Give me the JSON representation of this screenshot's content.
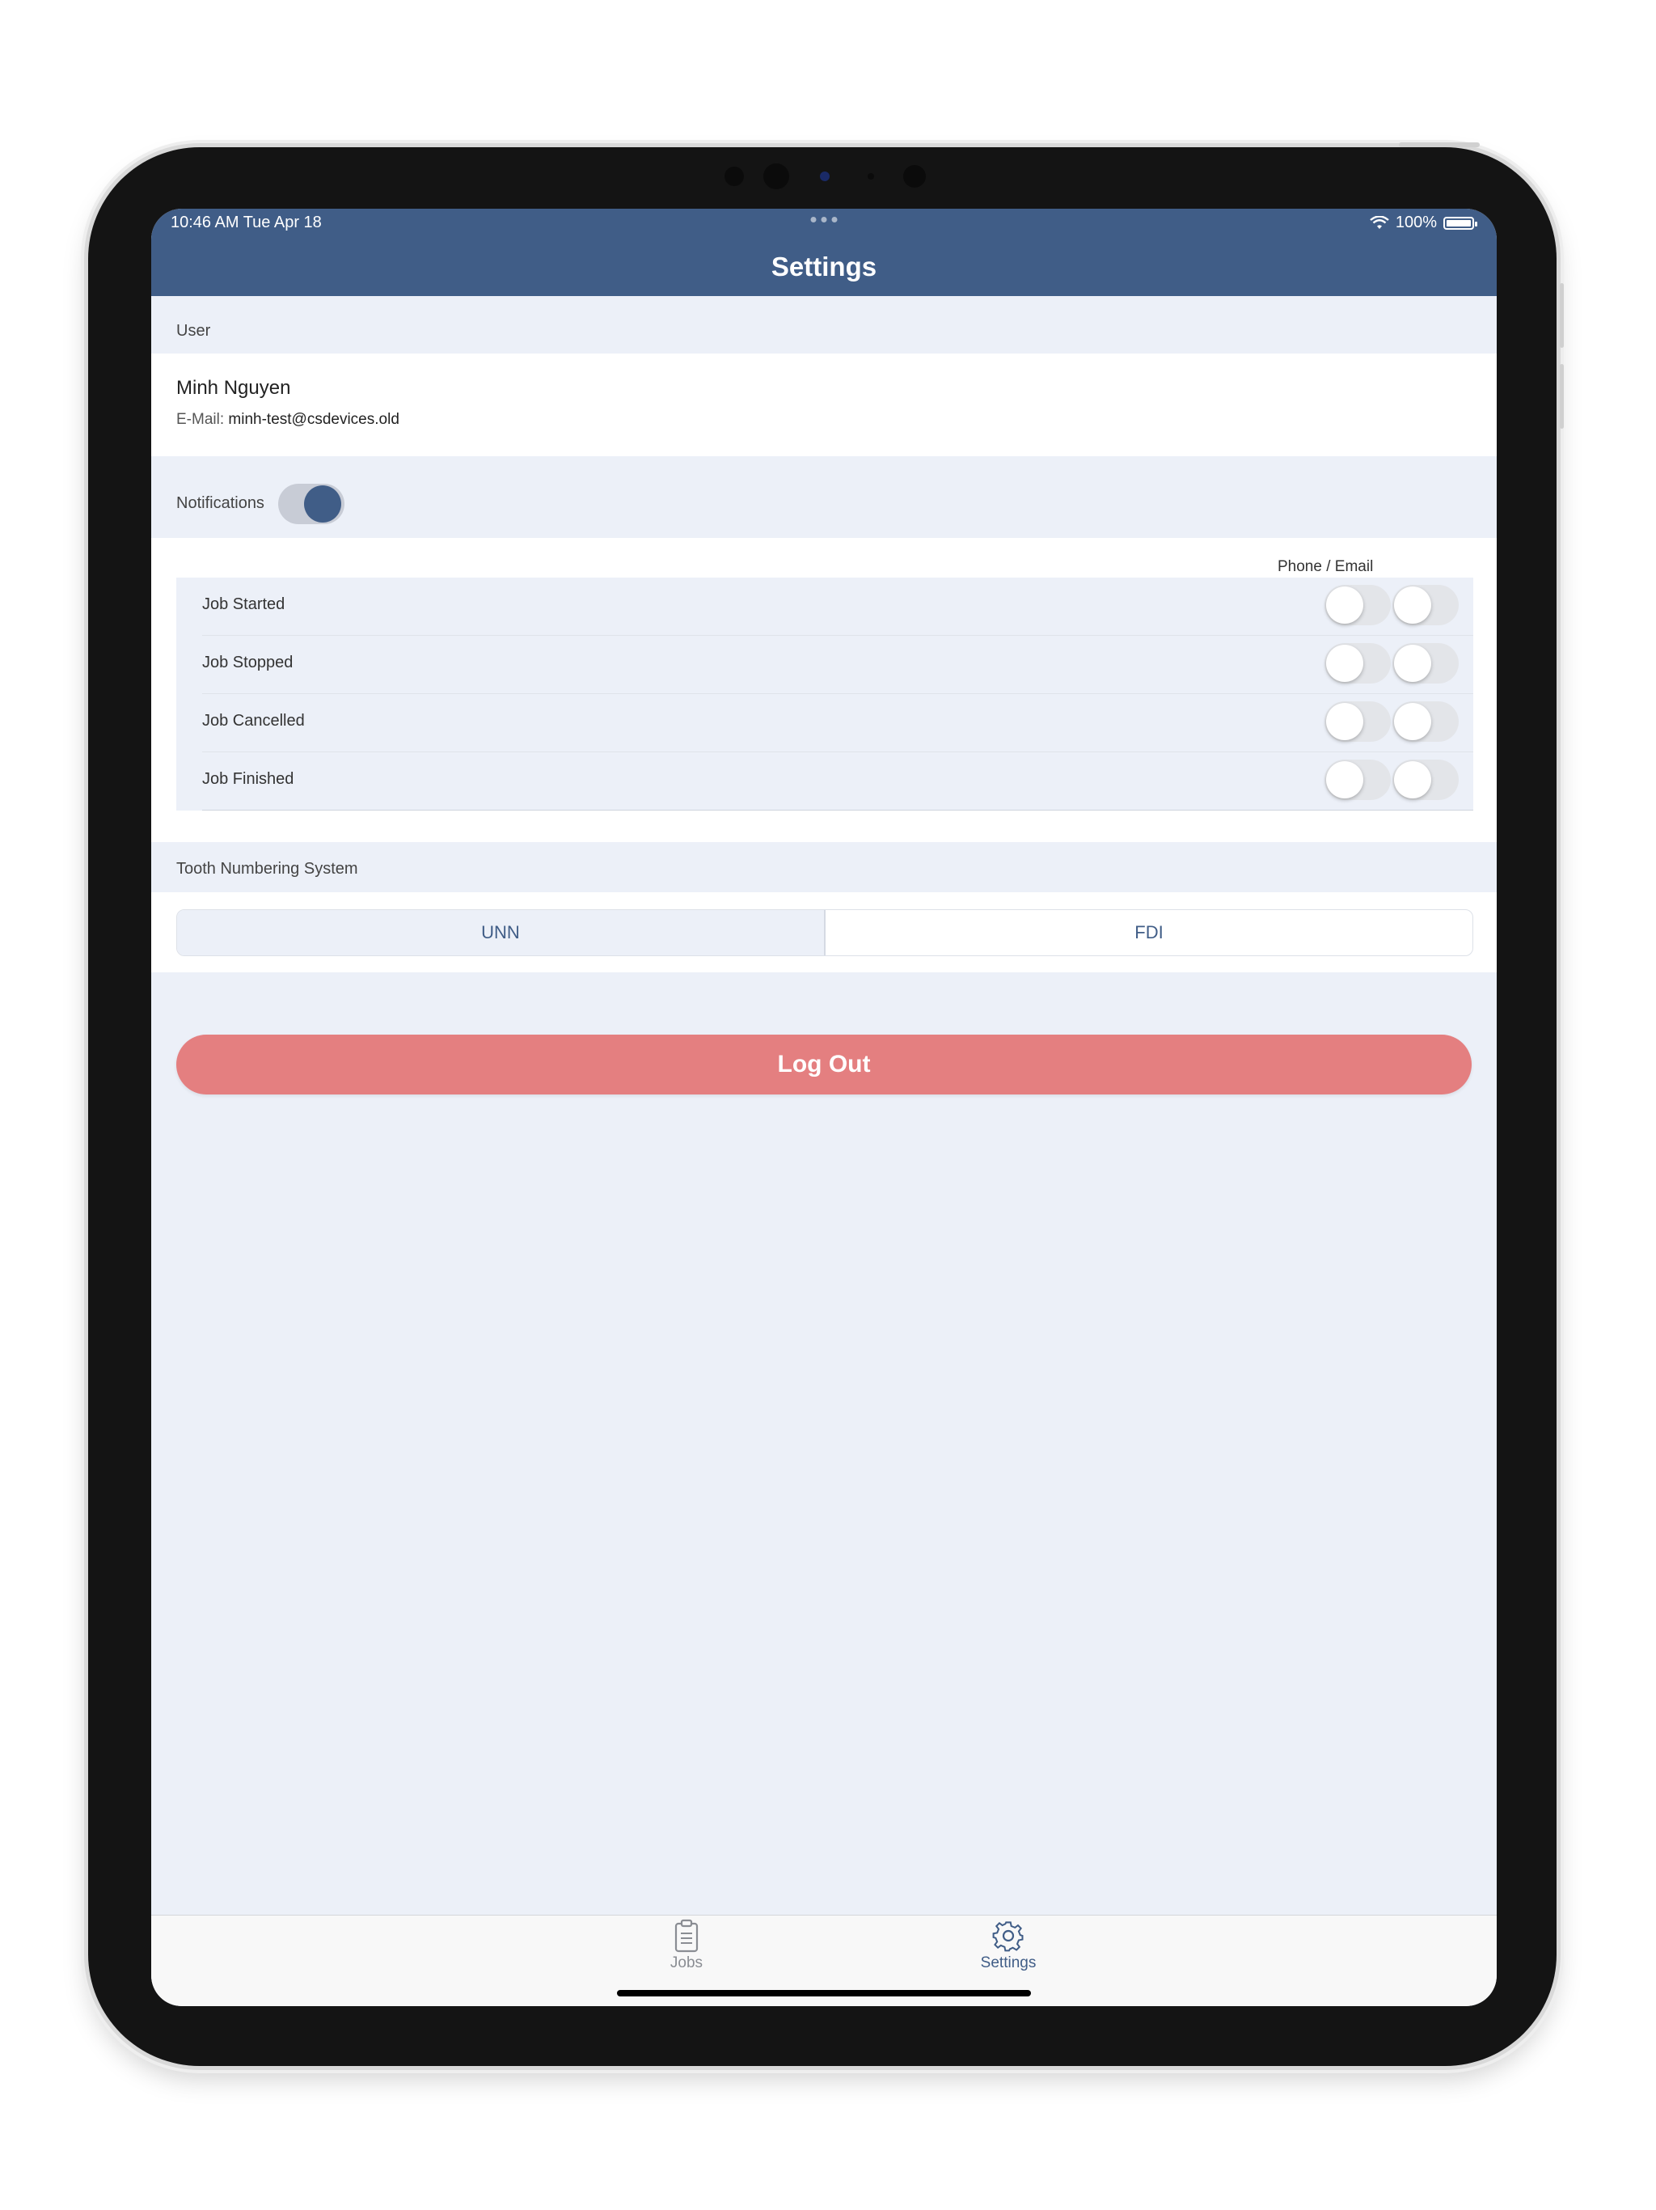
{
  "status_bar": {
    "time": "10:46 AM   Tue Apr 18",
    "battery": "100%"
  },
  "navbar": {
    "title": "Settings"
  },
  "user": {
    "section_label": "User",
    "name": "Minh Nguyen",
    "email_label": "E-Mail:",
    "email": "minh-test@csdevices.old"
  },
  "notifications": {
    "label": "Notifications",
    "enabled": true,
    "column_header": "Phone / Email",
    "events": [
      {
        "label": "Job Started",
        "phone": false,
        "email": false
      },
      {
        "label": "Job Stopped",
        "phone": false,
        "email": false
      },
      {
        "label": "Job Cancelled",
        "phone": false,
        "email": false
      },
      {
        "label": "Job Finished",
        "phone": false,
        "email": false
      }
    ]
  },
  "tooth_numbering": {
    "section_label": "Tooth Numbering System",
    "options": [
      "UNN",
      "FDI"
    ],
    "selected": "UNN"
  },
  "logout_label": "Log Out",
  "tabbar": {
    "tabs": [
      {
        "label": "Jobs",
        "icon": "clipboard-icon",
        "active": false
      },
      {
        "label": "Settings",
        "icon": "gear-icon",
        "active": true
      }
    ]
  },
  "colors": {
    "nav": "#405d87",
    "background": "#ecf0f8",
    "logout": "#e47f80"
  }
}
